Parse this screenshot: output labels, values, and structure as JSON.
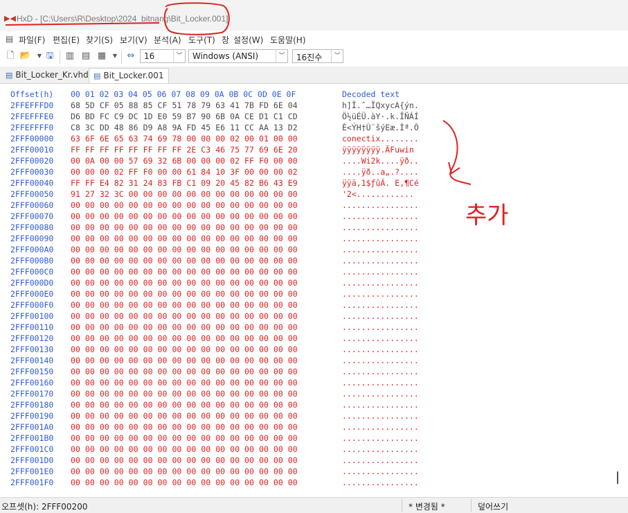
{
  "window": {
    "title": "HxD - [C:\\Users\\R\\Desktop\\2024_bitnang\\Bit_Locker.001]",
    "app_icon": "hxd-logo-icon"
  },
  "menu": {
    "items": [
      "파일(F)",
      "편집(E)",
      "찾기(S)",
      "보기(V)",
      "분석(A)",
      "도구(T)",
      "창",
      "설정(W)",
      "도움말(H)"
    ]
  },
  "toolbar": {
    "icons": [
      "new-file-icon",
      "open-folder-icon",
      "save-icon",
      "close-icon",
      "properties-icon",
      "print-icon",
      "goto-icon"
    ],
    "bytes_per_row": "16",
    "charset": "Windows (ANSI)",
    "offset_base": "16진수"
  },
  "tabs": [
    {
      "label": "Bit_Locker_Kr.vhd",
      "active": false
    },
    {
      "label": "Bit_Locker.001",
      "active": true
    }
  ],
  "editor": {
    "offset_header": "Offset(h)",
    "column_header": "00 01 02 03 04 05 06 07 08 09 0A 0B 0C 0D 0E 0F",
    "decoded_header": "Decoded text",
    "rows": [
      {
        "offset": "2FFEFFFD0",
        "hex": "68 5D CF 05 88 85 CF 51 78 79 63 41 7B FD 6E 04",
        "text": "h]Ï.ˆ…ÏQxycA{ýn.",
        "modified": false
      },
      {
        "offset": "2FFEFFFE0",
        "hex": "D6 BD FC C9 DC 1D E0 59 B7 90 6B 0A CE D1 C1 CD",
        "text": "Ö½üÉÜ.àY·.k.ÎÑÁÍ",
        "modified": false
      },
      {
        "offset": "2FFEFFFF0",
        "hex": "C8 3C DD 48 86 D9 A8 9A FD 45 E6 11 CC AA 13 D2",
        "text": "È<ÝH†Ù¨šýEæ.Ìª.Ò",
        "modified": false
      },
      {
        "offset": "2FFF00000",
        "hex": "63 6F 6E 65 63 74 69 78 00 00 00 02 00 01 00 00",
        "text": "conectix........",
        "modified": true
      },
      {
        "offset": "2FFF00010",
        "hex": "FF FF FF FF FF FF FF FF 2E C3 46 75 77 69 6E 20",
        "text": "ÿÿÿÿÿÿÿÿ.ÃFuwin ",
        "modified": true
      },
      {
        "offset": "2FFF00020",
        "hex": "00 0A 00 00 57 69 32 6B 00 00 00 02 FF F0 00 00",
        "text": "....Wi2k....ÿð..",
        "modified": true
      },
      {
        "offset": "2FFF00030",
        "hex": "00 00 00 02 FF F0 00 00 61 84 10 3F 00 00 00 02",
        "text": "....ÿð..a„.?....",
        "modified": true
      },
      {
        "offset": "2FFF00040",
        "hex": "FF FF E4 82 31 24 83 FB C1 09 20 45 82 B6 43 E9",
        "text": "ÿÿä‚1$ƒûÁ. E‚¶Cé",
        "modified": true
      },
      {
        "offset": "2FFF00050",
        "hex": "91 27 32 3C 00 00 00 00 00 00 00 00 00 00 00 00",
        "text": "'2<............",
        "modified": true
      },
      {
        "offset": "2FFF00060",
        "hex": "00 00 00 00 00 00 00 00 00 00 00 00 00 00 00 00",
        "text": "................",
        "modified": true
      },
      {
        "offset": "2FFF00070",
        "hex": "00 00 00 00 00 00 00 00 00 00 00 00 00 00 00 00",
        "text": "................",
        "modified": true
      },
      {
        "offset": "2FFF00080",
        "hex": "00 00 00 00 00 00 00 00 00 00 00 00 00 00 00 00",
        "text": "................",
        "modified": true
      },
      {
        "offset": "2FFF00090",
        "hex": "00 00 00 00 00 00 00 00 00 00 00 00 00 00 00 00",
        "text": "................",
        "modified": true
      },
      {
        "offset": "2FFF000A0",
        "hex": "00 00 00 00 00 00 00 00 00 00 00 00 00 00 00 00",
        "text": "................",
        "modified": true
      },
      {
        "offset": "2FFF000B0",
        "hex": "00 00 00 00 00 00 00 00 00 00 00 00 00 00 00 00",
        "text": "................",
        "modified": true
      },
      {
        "offset": "2FFF000C0",
        "hex": "00 00 00 00 00 00 00 00 00 00 00 00 00 00 00 00",
        "text": "................",
        "modified": true
      },
      {
        "offset": "2FFF000D0",
        "hex": "00 00 00 00 00 00 00 00 00 00 00 00 00 00 00 00",
        "text": "................",
        "modified": true
      },
      {
        "offset": "2FFF000E0",
        "hex": "00 00 00 00 00 00 00 00 00 00 00 00 00 00 00 00",
        "text": "................",
        "modified": true
      },
      {
        "offset": "2FFF000F0",
        "hex": "00 00 00 00 00 00 00 00 00 00 00 00 00 00 00 00",
        "text": "................",
        "modified": true
      },
      {
        "offset": "2FFF00100",
        "hex": "00 00 00 00 00 00 00 00 00 00 00 00 00 00 00 00",
        "text": "................",
        "modified": true
      },
      {
        "offset": "2FFF00110",
        "hex": "00 00 00 00 00 00 00 00 00 00 00 00 00 00 00 00",
        "text": "................",
        "modified": true
      },
      {
        "offset": "2FFF00120",
        "hex": "00 00 00 00 00 00 00 00 00 00 00 00 00 00 00 00",
        "text": "................",
        "modified": true
      },
      {
        "offset": "2FFF00130",
        "hex": "00 00 00 00 00 00 00 00 00 00 00 00 00 00 00 00",
        "text": "................",
        "modified": true
      },
      {
        "offset": "2FFF00140",
        "hex": "00 00 00 00 00 00 00 00 00 00 00 00 00 00 00 00",
        "text": "................",
        "modified": true
      },
      {
        "offset": "2FFF00150",
        "hex": "00 00 00 00 00 00 00 00 00 00 00 00 00 00 00 00",
        "text": "................",
        "modified": true
      },
      {
        "offset": "2FFF00160",
        "hex": "00 00 00 00 00 00 00 00 00 00 00 00 00 00 00 00",
        "text": "................",
        "modified": true
      },
      {
        "offset": "2FFF00170",
        "hex": "00 00 00 00 00 00 00 00 00 00 00 00 00 00 00 00",
        "text": "................",
        "modified": true
      },
      {
        "offset": "2FFF00180",
        "hex": "00 00 00 00 00 00 00 00 00 00 00 00 00 00 00 00",
        "text": "................",
        "modified": true
      },
      {
        "offset": "2FFF00190",
        "hex": "00 00 00 00 00 00 00 00 00 00 00 00 00 00 00 00",
        "text": "................",
        "modified": true
      },
      {
        "offset": "2FFF001A0",
        "hex": "00 00 00 00 00 00 00 00 00 00 00 00 00 00 00 00",
        "text": "................",
        "modified": true
      },
      {
        "offset": "2FFF001B0",
        "hex": "00 00 00 00 00 00 00 00 00 00 00 00 00 00 00 00",
        "text": "................",
        "modified": true
      },
      {
        "offset": "2FFF001C0",
        "hex": "00 00 00 00 00 00 00 00 00 00 00 00 00 00 00 00",
        "text": "................",
        "modified": true
      },
      {
        "offset": "2FFF001D0",
        "hex": "00 00 00 00 00 00 00 00 00 00 00 00 00 00 00 00",
        "text": "................",
        "modified": true
      },
      {
        "offset": "2FFF001E0",
        "hex": "00 00 00 00 00 00 00 00 00 00 00 00 00 00 00 00",
        "text": "................",
        "modified": true
      },
      {
        "offset": "2FFF001F0",
        "hex": "00 00 00 00 00 00 00 00 00 00 00 00 00 00 00 00",
        "text": "................",
        "modified": true
      }
    ]
  },
  "status": {
    "offset": "오프셋(h): 2FFF00200",
    "changed": "* 변경됨 *",
    "mode": "덮어쓰기"
  },
  "annotation": {
    "handwritten_note": "추가",
    "color": "#e02020"
  },
  "colors": {
    "offset_blue": "#2d5bd6",
    "modified_red": "#e02020"
  }
}
